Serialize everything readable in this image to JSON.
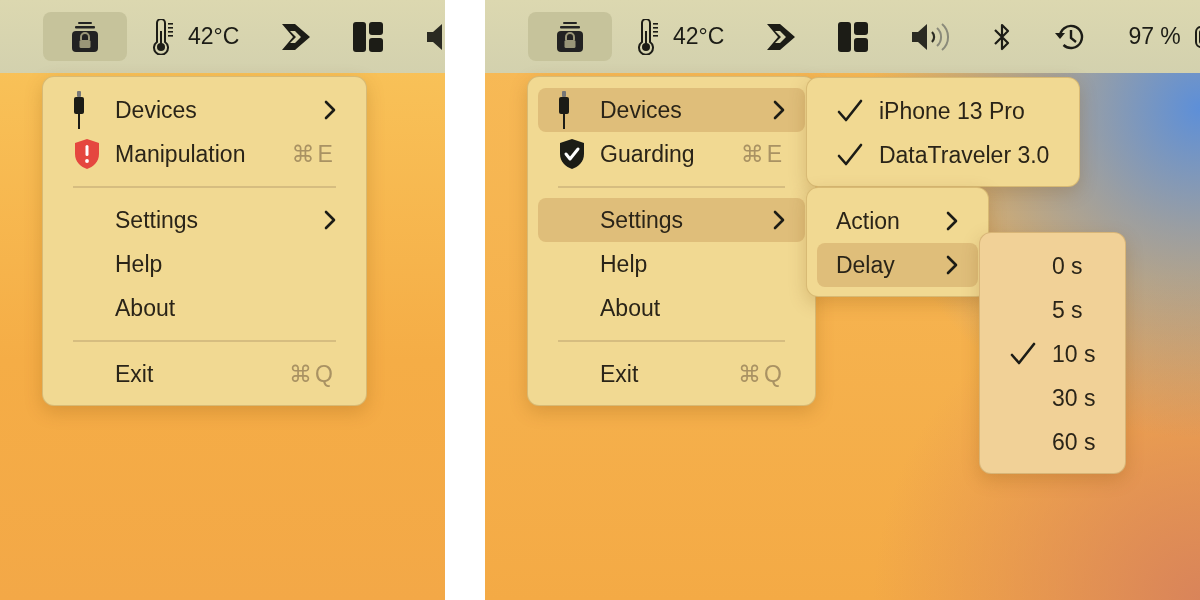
{
  "panels": [
    {
      "menu_bar": {
        "items": [
          {
            "kind": "app",
            "selected": true
          },
          {
            "kind": "temperature",
            "selected": false,
            "text": "42°C"
          },
          {
            "kind": "dash",
            "selected": false
          },
          {
            "kind": "layout",
            "selected": false
          },
          {
            "kind": "volume",
            "selected": false
          }
        ]
      },
      "menu": {
        "items": [
          {
            "kind": "plug",
            "label": "Devices",
            "submenu": true,
            "selected": false
          },
          {
            "kind": "alert",
            "label": "Manipulation",
            "shortcut": "⌘E",
            "selected": false
          },
          {
            "kind": "separator"
          },
          {
            "kind": "item",
            "label": "Settings",
            "submenu": true,
            "selected": false
          },
          {
            "kind": "item",
            "label": "Help",
            "selected": false
          },
          {
            "kind": "item",
            "label": "About",
            "selected": false
          },
          {
            "kind": "separator"
          },
          {
            "kind": "item",
            "label": "Exit",
            "shortcut": "⌘Q",
            "selected": false
          }
        ]
      }
    },
    {
      "menu_bar": {
        "items": [
          {
            "kind": "app",
            "selected": true
          },
          {
            "kind": "temperature",
            "selected": false,
            "text": "42°C"
          },
          {
            "kind": "dash",
            "selected": false
          },
          {
            "kind": "layout",
            "selected": false
          },
          {
            "kind": "volume",
            "selected": false
          },
          {
            "kind": "bluetooth",
            "selected": false
          },
          {
            "kind": "history",
            "selected": false
          },
          {
            "kind": "battery",
            "selected": false,
            "text": "97 %"
          }
        ]
      },
      "menu": {
        "items": [
          {
            "kind": "plug",
            "label": "Devices",
            "submenu": true,
            "selected": true,
            "children": [
              {
                "kind": "check",
                "label": "iPhone 13 Pro",
                "checked": true
              },
              {
                "kind": "check",
                "label": "DataTraveler 3.0",
                "checked": true
              }
            ]
          },
          {
            "kind": "guard",
            "label": "Guarding",
            "shortcut": "⌘E",
            "selected": false
          },
          {
            "kind": "separator"
          },
          {
            "kind": "item",
            "label": "Settings",
            "submenu": true,
            "selected": true,
            "children": [
              {
                "kind": "item",
                "label": "Action",
                "submenu": true,
                "selected": false
              },
              {
                "kind": "item",
                "label": "Delay",
                "submenu": true,
                "selected": true,
                "children": [
                  {
                    "kind": "check",
                    "label": "0 s",
                    "checked": false
                  },
                  {
                    "kind": "check",
                    "label": "5 s",
                    "checked": false
                  },
                  {
                    "kind": "check",
                    "label": "10 s",
                    "checked": true
                  },
                  {
                    "kind": "check",
                    "label": "30 s",
                    "checked": false
                  },
                  {
                    "kind": "check",
                    "label": "60 s",
                    "checked": false
                  }
                ]
              }
            ]
          },
          {
            "kind": "item",
            "label": "Help",
            "selected": false
          },
          {
            "kind": "item",
            "label": "About",
            "selected": false
          },
          {
            "kind": "separator"
          },
          {
            "kind": "item",
            "label": "Exit",
            "shortcut": "⌘Q",
            "selected": false
          }
        ]
      }
    }
  ]
}
